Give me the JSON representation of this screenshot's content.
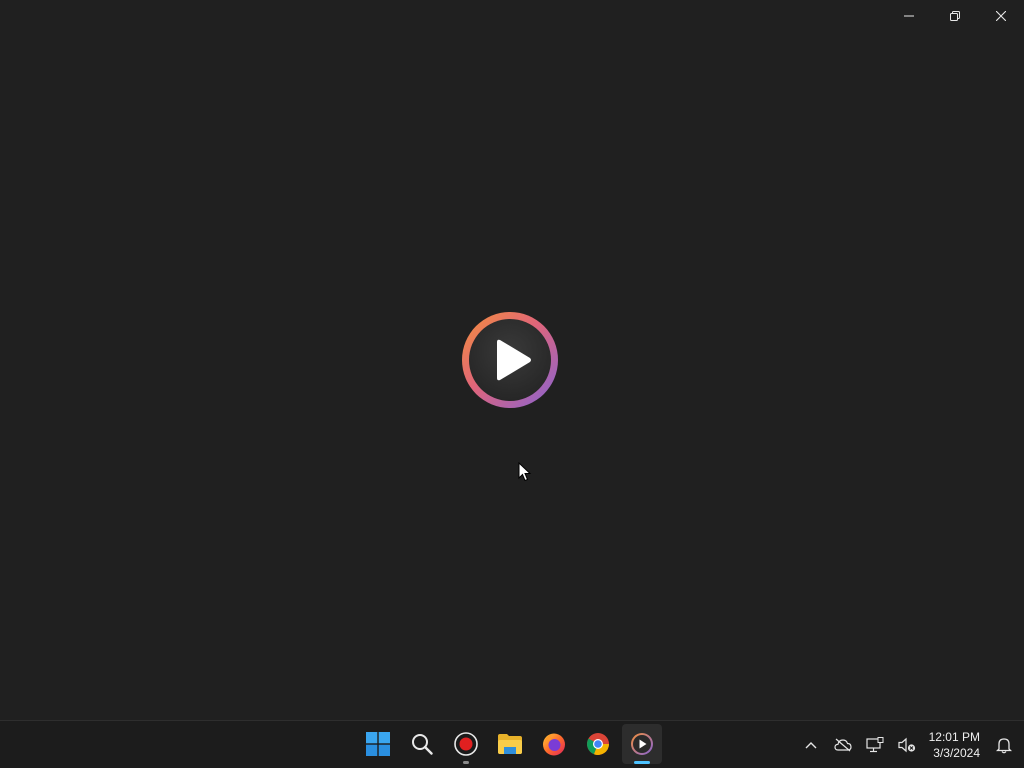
{
  "window": {
    "controls": {
      "minimize_icon": "minimize-icon",
      "restore_icon": "restore-icon",
      "close_icon": "close-icon"
    },
    "splash_logo_icon": "media-player-play-logo"
  },
  "taskbar": {
    "pinned": [
      {
        "name": "start",
        "icon": "windows-start-icon",
        "running": false,
        "focused": false
      },
      {
        "name": "search",
        "icon": "search-icon",
        "running": false,
        "focused": false
      },
      {
        "name": "screen-recorder",
        "icon": "record-icon",
        "running": true,
        "focused": false
      },
      {
        "name": "file-explorer",
        "icon": "folder-icon",
        "running": false,
        "focused": false
      },
      {
        "name": "firefox",
        "icon": "firefox-icon",
        "running": false,
        "focused": false
      },
      {
        "name": "chrome",
        "icon": "chrome-icon",
        "running": false,
        "focused": false
      },
      {
        "name": "media-player",
        "icon": "media-player-icon",
        "running": true,
        "focused": true
      }
    ],
    "tray": {
      "icons": [
        "chevron-up-icon",
        "onedrive-offline-icon",
        "network-icon",
        "volume-muted-icon",
        "notification-bell-icon"
      ],
      "time": "12:01 PM",
      "date": "3/3/2024"
    }
  },
  "colors": {
    "background": "#202020",
    "taskbar": "#1c1c1c",
    "accent": "#4cc2ff",
    "logo_gradient_start": "#f0883c",
    "logo_gradient_end": "#8a63d2"
  }
}
